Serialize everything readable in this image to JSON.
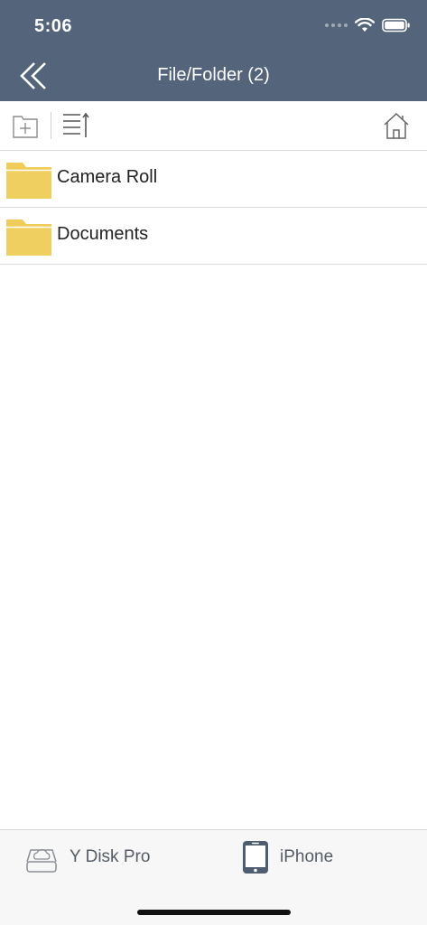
{
  "status_bar": {
    "time": "5:06"
  },
  "header": {
    "title": "File/Folder (2)",
    "back_icon": "double-chevron-left-icon",
    "background_color": "#54647a"
  },
  "toolbar": {
    "new_folder_icon": "add-folder-icon",
    "sort_icon": "sort-list-icon",
    "home_icon": "home-icon"
  },
  "files": [
    {
      "name": "Camera Roll",
      "icon": "folder-icon",
      "color": "#f0cd5b"
    },
    {
      "name": "Documents",
      "icon": "folder-icon",
      "color": "#f0cd5b"
    }
  ],
  "tabbar": {
    "tabs": [
      {
        "label": "Y Disk Pro",
        "icon": "cloud-disk-icon"
      },
      {
        "label": "iPhone",
        "icon": "iphone-icon"
      }
    ]
  }
}
